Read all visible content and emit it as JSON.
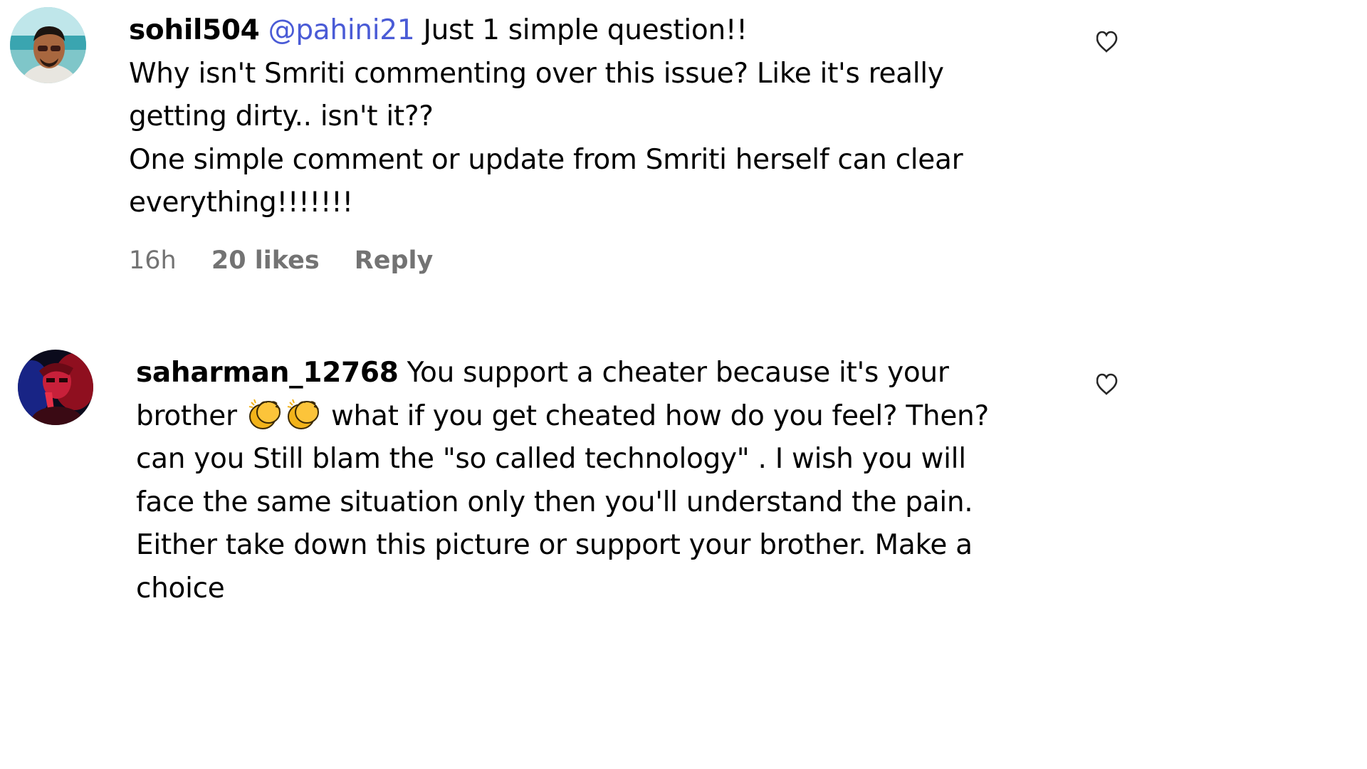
{
  "comments": [
    {
      "username": "sohil504",
      "mention": "@pahini21",
      "lines": [
        "Just 1 simple question!!",
        "Why isn't Smriti commenting over this issue? Like it's really",
        "getting dirty.. isn't it??",
        "One simple comment or update from Smriti herself can clear",
        "everything!!!!!!!"
      ],
      "time": "16h",
      "likes": "20 likes",
      "reply_label": "Reply"
    },
    {
      "username": "saharman_12768",
      "lines": [
        "You support a cheater because it's your",
        "brother",
        "what if you get cheated how do you feel? Then?",
        "can you Still blam the \"so called technology\" . I wish you will",
        "face the same situation only then you'll understand the pain.",
        "Either take down this picture or support your brother. Make a",
        "choice"
      ]
    }
  ],
  "icons": {
    "like": "heart-outline-icon",
    "clap": "clapping-hands-emoji"
  },
  "colors": {
    "mention": "#4a5bd6",
    "meta": "#737373",
    "text": "#000000"
  }
}
